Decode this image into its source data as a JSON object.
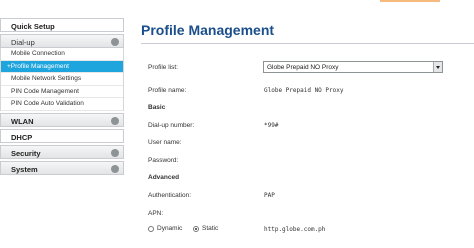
{
  "sidebar": {
    "quick_setup": "Quick Setup",
    "dialup": "Dial-up",
    "dialup_items": [
      "Mobile Connection",
      "+Profile Management",
      "Mobile Network Settings",
      "PIN Code Management",
      "PIN Code Auto Validation"
    ],
    "wlan": "WLAN",
    "dhcp": "DHCP",
    "security": "Security",
    "system": "System",
    "toggle_symbol": "●"
  },
  "main": {
    "title": "Profile Management",
    "profile_list_label": "Profile list:",
    "profile_list_value": "Globe Prepaid NO Proxy",
    "profile_name_label": "Profile name:",
    "profile_name_value": "Globe Prepaid NO Proxy",
    "basic_header": "Basic",
    "dialup_number_label": "Dial-up number:",
    "dialup_number_value": "*99#",
    "username_label": "User name:",
    "password_label": "Password:",
    "advanced_header": "Advanced",
    "authentication_label": "Authentication:",
    "authentication_value": "PAP",
    "apn_label": "APN:",
    "apn_dynamic": "Dynamic",
    "apn_static": "Static",
    "apn_value": "http.globe.com.ph"
  },
  "colors": {
    "accent_blue": "#1fa5dd",
    "title_blue": "#1a4f8b"
  }
}
